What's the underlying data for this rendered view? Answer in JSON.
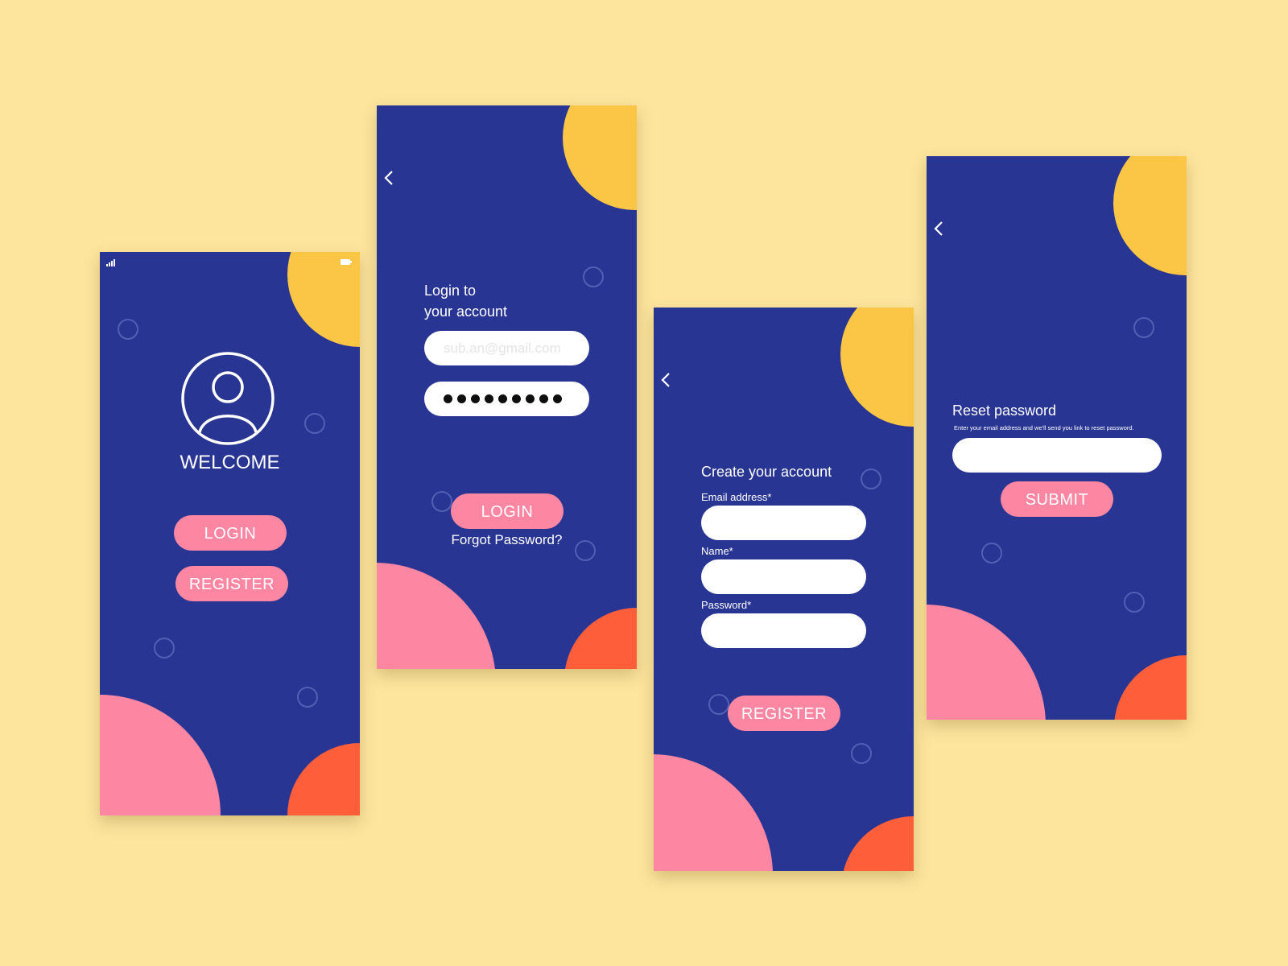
{
  "welcome_screen": {
    "title": "WELCOME",
    "login_label": "LOGIN",
    "register_label": "REGISTER",
    "icons": [
      "signal-icon",
      "battery-icon",
      "user-avatar-icon"
    ]
  },
  "login_screen": {
    "heading_line1": "Login to",
    "heading_line2": "your account",
    "email_placeholder": "sub.an@gmail.com",
    "password_dots": 9,
    "login_label": "LOGIN",
    "forgot_label": "Forgot Password?",
    "icons": [
      "back-arrow-icon"
    ]
  },
  "register_screen": {
    "heading": "Create your account",
    "email_label": "Email address*",
    "name_label": "Name*",
    "password_label": "Password*",
    "register_label": "REGISTER",
    "icons": [
      "back-arrow-icon"
    ]
  },
  "reset_screen": {
    "heading": "Reset password",
    "subtext": "Enter your email address and we'll send you link to reset password.",
    "submit_label": "SUBMIT",
    "icons": [
      "back-arrow-icon"
    ]
  },
  "colors": {
    "page_background": "#fde59e",
    "screen_background": "#283593",
    "button_pink": "#fd87a3",
    "blob_yellow": "#fbc645",
    "blob_pink": "#fd87a3",
    "blob_orange": "#ff5e3b",
    "field_white": "#ffffff"
  }
}
